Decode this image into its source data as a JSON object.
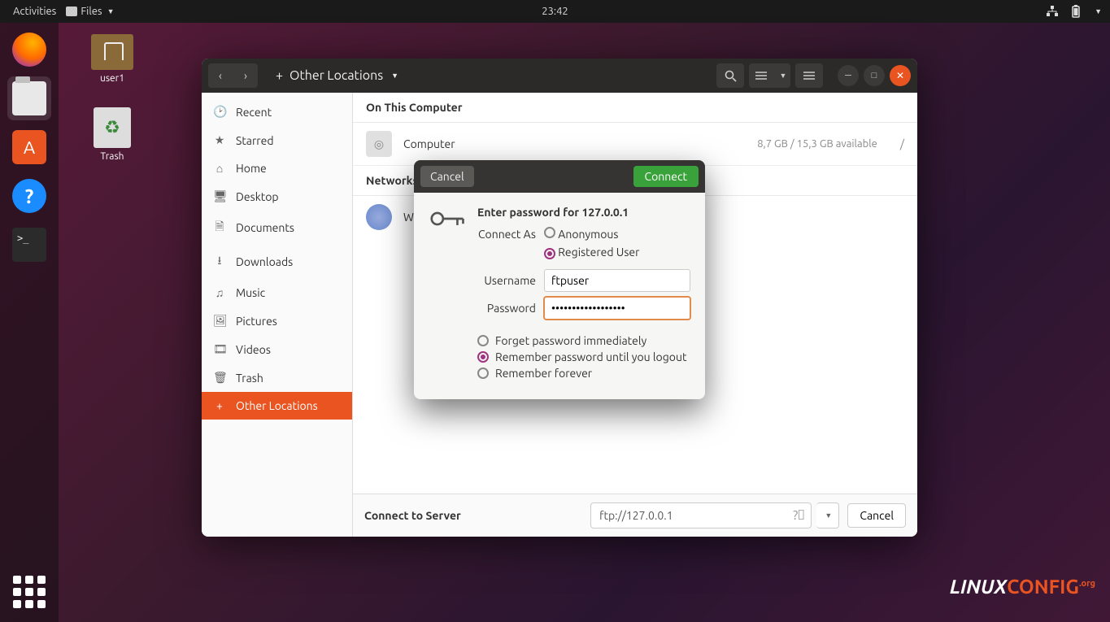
{
  "topbar": {
    "activities": "Activities",
    "appmenu": "Files",
    "clock": "23:42"
  },
  "desktop": {
    "user_folder": "user1",
    "trash": "Trash"
  },
  "window": {
    "location": "Other Locations",
    "sidebar": [
      {
        "icon": "🕑",
        "label": "Recent"
      },
      {
        "icon": "★",
        "label": "Starred"
      },
      {
        "icon": "⌂",
        "label": "Home"
      },
      {
        "icon": "🖥",
        "label": "Desktop"
      },
      {
        "icon": "🗎",
        "label": "Documents"
      },
      {
        "icon": "⭳",
        "label": "Downloads"
      },
      {
        "icon": "♫",
        "label": "Music"
      },
      {
        "icon": "🖼",
        "label": "Pictures"
      },
      {
        "icon": "🎞",
        "label": "Videos"
      },
      {
        "icon": "🗑",
        "label": "Trash"
      }
    ],
    "other_locations_label": "Other Locations",
    "section_computer": "On This Computer",
    "computer_row": {
      "label": "Computer",
      "size": "8,7 GB / 15,3 GB available",
      "mount": "/"
    },
    "section_networks": "Networks",
    "network_row": {
      "label": "W"
    },
    "footer": {
      "label": "Connect to Server",
      "address": "ftp://127.0.0.1",
      "cancel": "Cancel"
    }
  },
  "dialog": {
    "cancel": "Cancel",
    "connect": "Connect",
    "title": "Enter password for 127.0.0.1",
    "connect_as": "Connect As",
    "anon": "Anonymous",
    "reg": "Registered User",
    "username_label": "Username",
    "username": "ftpuser",
    "password_label": "Password",
    "password": "••••••••••••••••••",
    "remember": {
      "forget": "Forget password immediately",
      "session": "Remember password until you logout",
      "forever": "Remember forever"
    }
  },
  "branding": {
    "a": "LINUX",
    "b": "CONFIG",
    "c": ".org"
  }
}
